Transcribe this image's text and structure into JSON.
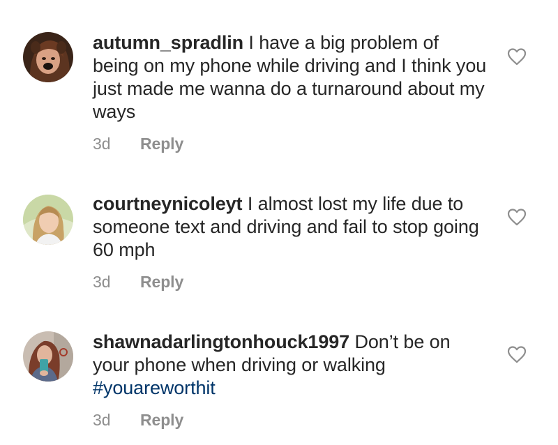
{
  "comments": [
    {
      "username": "autumn_spradlin",
      "text": " I have a big problem of being on my phone while driving and I think you just made me wanna do a turnaround about my ways",
      "hashtag": "",
      "time": "3d",
      "reply_label": "Reply",
      "like_icon": "heart-outline-icon"
    },
    {
      "username": "courtneynicoleyt",
      "text": " I almost lost my life due to someone text and driving and fail to stop going 60 mph",
      "hashtag": "",
      "time": "3d",
      "reply_label": "Reply",
      "like_icon": "heart-outline-icon"
    },
    {
      "username": "shawnadarlingtonhouck1997",
      "text": " Don’t be on your phone when driving or walking ",
      "hashtag": "#youareworthit",
      "time": "3d",
      "reply_label": "Reply",
      "like_icon": "heart-outline-icon"
    }
  ],
  "colors": {
    "text": "#262626",
    "secondary": "#8e8e8e",
    "hashtag": "#003569",
    "background": "#ffffff"
  }
}
